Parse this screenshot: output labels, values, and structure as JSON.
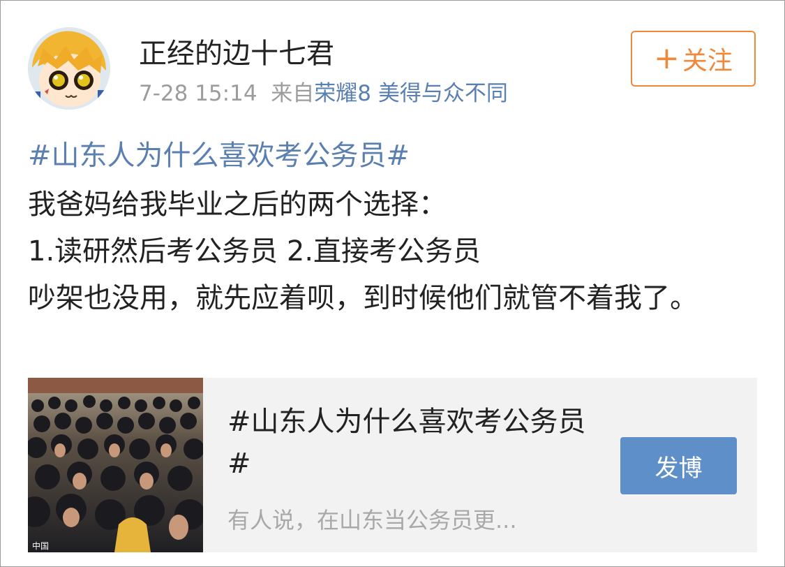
{
  "post": {
    "username": "正经的边十七君",
    "time": "7-28 15:14",
    "from_prefix": "来自",
    "source": "荣耀8 美得与众不同",
    "follow_plus": "+",
    "follow_label": "关注",
    "hashtag": "#山东人为什么喜欢考公务员#",
    "lines": [
      "我爸妈给我毕业之后的两个选择：",
      "1.读研然后考公务员 2.直接考公务员",
      "吵架也没用，就先应着呗，到时候他们就管不着我了。"
    ]
  },
  "card": {
    "title": "#山东人为什么喜欢考公务员#",
    "desc": "有人说，在山东当公务员更...",
    "button": "发博",
    "image_watermark": "中国"
  },
  "colors": {
    "link": "#5a7fb0",
    "follow": "#f0883a",
    "button": "#5f8fc9"
  }
}
